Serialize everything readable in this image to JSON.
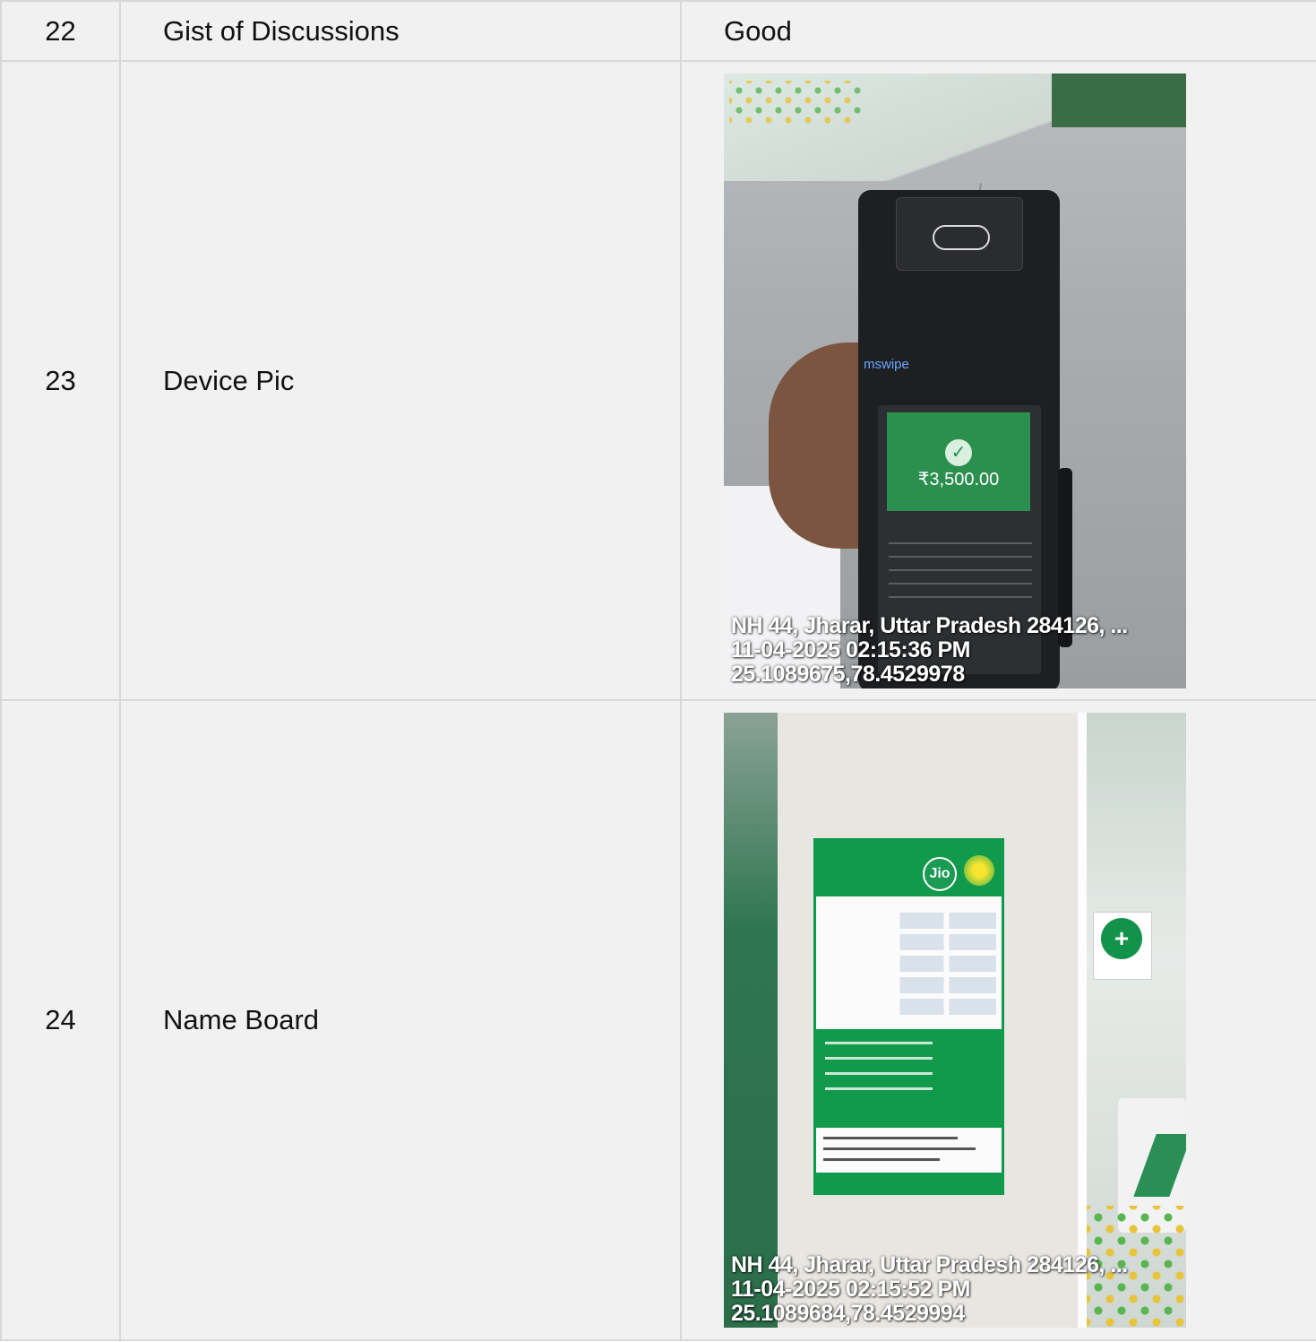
{
  "rows": [
    {
      "num": "22",
      "label": "Gist of Discussions",
      "value": "Good"
    },
    {
      "num": "23",
      "label": "Device Pic",
      "photo": {
        "subject": "POS device",
        "brand_text": "mswipe",
        "screen_amount": "₹3,500.00",
        "overlay": [
          "NH 44, Jharar, Uttar Pradesh 284126, ...",
          "11-04-2025 02:15:36 PM",
          "25.1089675,78.4529978"
        ]
      }
    },
    {
      "num": "24",
      "label": "Name Board",
      "photo": {
        "subject": "name board",
        "board_logo": "Jio",
        "overlay": [
          "NH 44, Jharar, Uttar Pradesh 284126, ...",
          "11-04-2025 02:15:52 PM",
          "25.1089684,78.4529994"
        ]
      }
    }
  ]
}
